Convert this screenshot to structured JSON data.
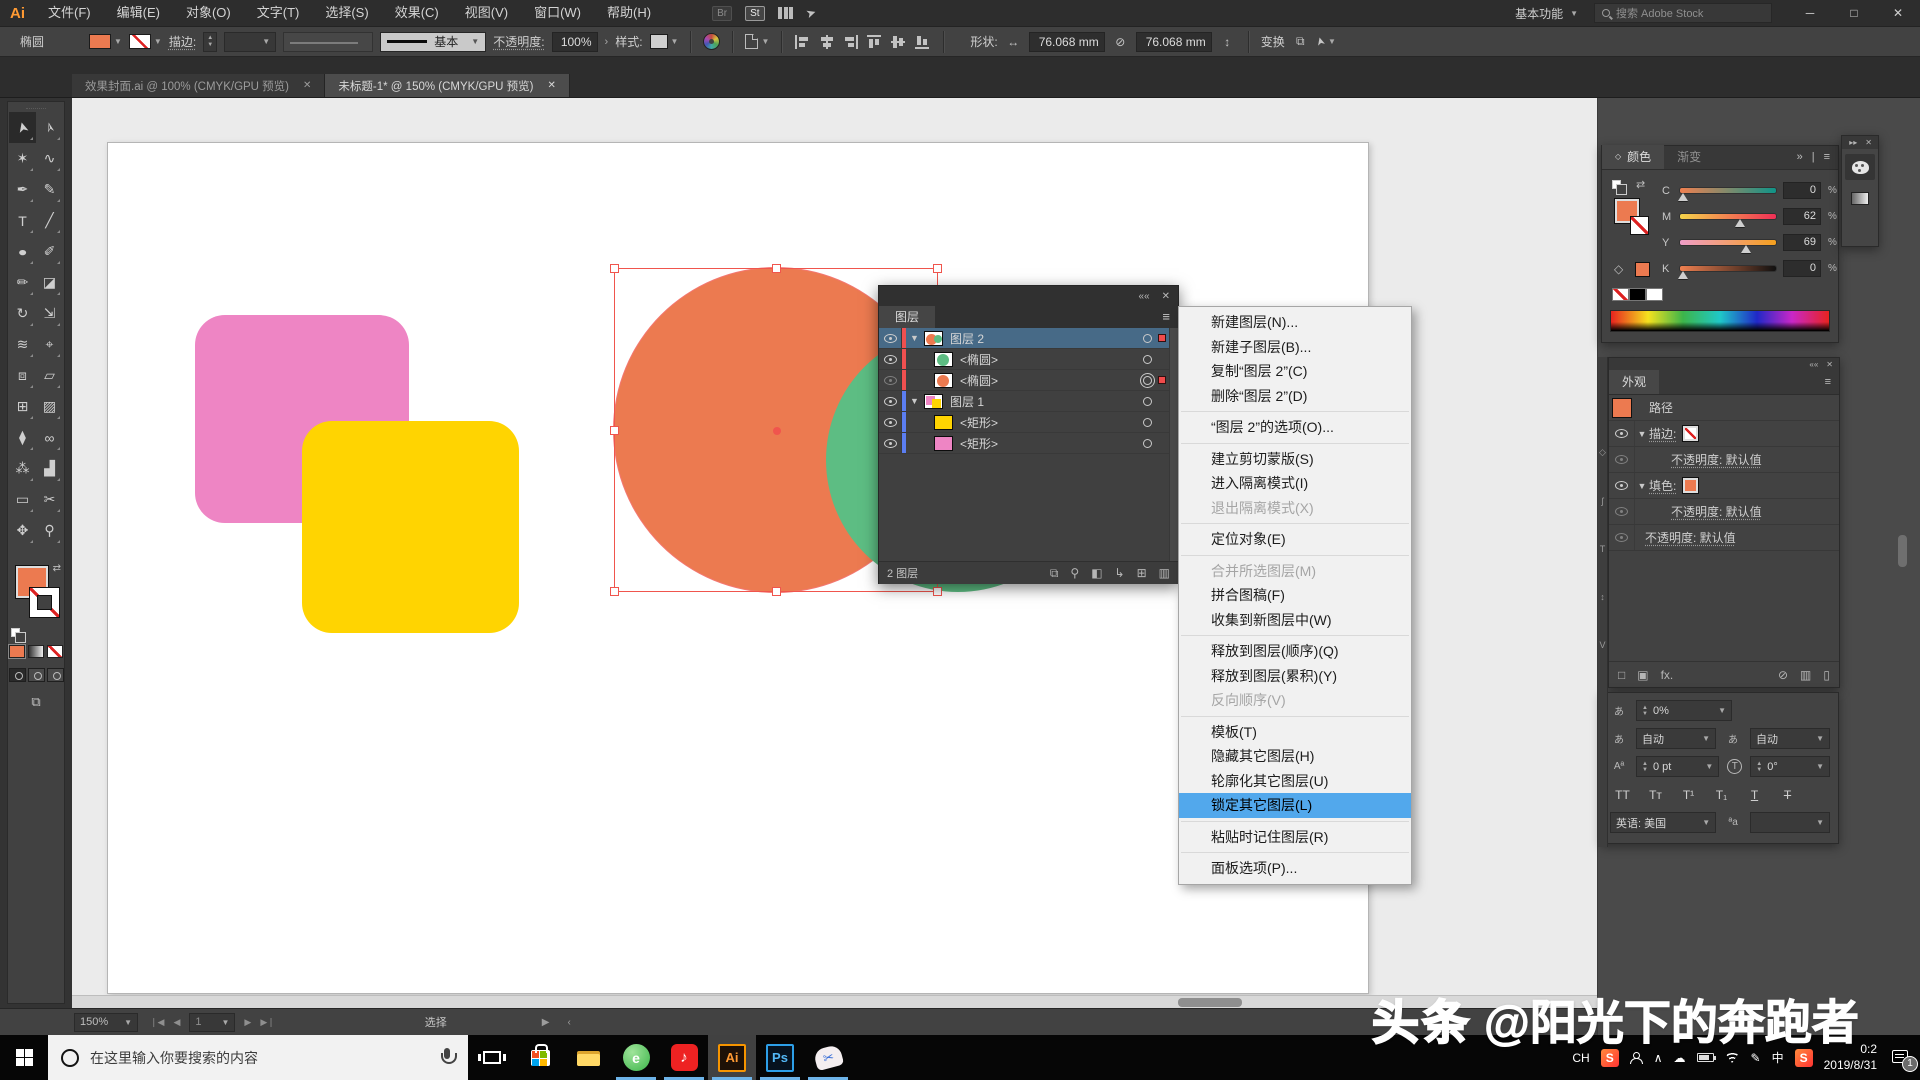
{
  "app": {
    "logo": "Ai",
    "workspace": "基本功能",
    "search_placeholder": "搜索 Adobe Stock",
    "bridge": "Br",
    "stock": "St"
  },
  "window_controls": {
    "minimize": "─",
    "maximize": "□",
    "close": "✕"
  },
  "menu_bar": {
    "items": [
      "文件(F)",
      "编辑(E)",
      "对象(O)",
      "文字(T)",
      "选择(S)",
      "效果(C)",
      "视图(V)",
      "窗口(W)",
      "帮助(H)"
    ]
  },
  "control_bar": {
    "tool": "椭圆",
    "stroke_label": "描边:",
    "brush_basic": "基本",
    "opacity_label": "不透明度:",
    "opacity_value": "100%",
    "style_label": "样式:",
    "shape_label": "形状:",
    "width": "76.068 mm",
    "height": "76.068 mm",
    "transform": "变换"
  },
  "tabs": [
    {
      "title": "效果封面.ai @ 100% (CMYK/GPU 预览)",
      "active": false
    },
    {
      "title": "未标题-1* @ 150% (CMYK/GPU 预览)",
      "active": true
    }
  ],
  "tools": [
    {
      "name": "selection",
      "glyph": "➤",
      "active": true,
      "rotate": true
    },
    {
      "name": "direct-selection",
      "glyph": "➢",
      "rotate": true
    },
    {
      "name": "magic-wand",
      "glyph": "✶"
    },
    {
      "name": "lasso",
      "glyph": "∿"
    },
    {
      "name": "pen",
      "glyph": "✒"
    },
    {
      "name": "curvature",
      "glyph": "✎"
    },
    {
      "name": "type",
      "glyph": "T"
    },
    {
      "name": "line-segment",
      "glyph": "╱"
    },
    {
      "name": "ellipse",
      "glyph": "●",
      "wide": true
    },
    {
      "name": "paintbrush",
      "glyph": "✐"
    },
    {
      "name": "shaper",
      "glyph": "✏"
    },
    {
      "name": "eraser",
      "glyph": "◪"
    },
    {
      "name": "rotate",
      "glyph": "↻"
    },
    {
      "name": "scale",
      "glyph": "⇲"
    },
    {
      "name": "width-tool",
      "glyph": "≋"
    },
    {
      "name": "puppet-warp",
      "glyph": "⌖"
    },
    {
      "name": "shape-builder",
      "glyph": "⧈"
    },
    {
      "name": "perspective-grid",
      "glyph": "▱"
    },
    {
      "name": "mesh",
      "glyph": "⊞"
    },
    {
      "name": "gradient",
      "glyph": "▨"
    },
    {
      "name": "eyedropper",
      "glyph": "⧫"
    },
    {
      "name": "blend",
      "glyph": "∞"
    },
    {
      "name": "symbol-sprayer",
      "glyph": "⁂"
    },
    {
      "name": "column-graph",
      "glyph": "▟"
    },
    {
      "name": "artboard",
      "glyph": "▭"
    },
    {
      "name": "slice",
      "glyph": "✂"
    },
    {
      "name": "hand",
      "glyph": "✥"
    },
    {
      "name": "zoom",
      "glyph": "⚲"
    }
  ],
  "canvas": {
    "artboard_color": "#ffffff",
    "shapes": {
      "pink": "#ee85c4",
      "yellow": "#ffd401",
      "orange": "#ec7a50",
      "green": "#5dbd83"
    },
    "selection_color": "#f0554d"
  },
  "layer_colors": {
    "red": "#f05050",
    "blue": "#5b7ef2"
  },
  "layers_panel": {
    "title": "图层",
    "rows": [
      {
        "name": "图层 2",
        "type": "layer",
        "color": "red",
        "thumb": "circles",
        "selected": true,
        "expanded": true,
        "target": "single",
        "proxy": true
      },
      {
        "name": "<椭圆>",
        "type": "item",
        "color": "red",
        "thumb": "green"
      },
      {
        "name": "<椭圆>",
        "type": "item",
        "color": "red",
        "thumb": "orange",
        "target": "double",
        "proxy": true,
        "dim": true
      },
      {
        "name": "图层 1",
        "type": "layer",
        "color": "blue",
        "thumb": "rects",
        "expanded": true,
        "target": "single"
      },
      {
        "name": "<矩形>",
        "type": "item",
        "color": "blue",
        "thumb": "yellow"
      },
      {
        "name": "<矩形>",
        "type": "item",
        "color": "blue",
        "thumb": "pink"
      }
    ],
    "status": "2 图层",
    "foot_icons": [
      {
        "name": "collect-for-export-icon",
        "glyph": "⧉"
      },
      {
        "name": "locate-object-icon",
        "glyph": "⚲"
      },
      {
        "name": "make-mask-icon",
        "glyph": "◧"
      },
      {
        "name": "new-sublayer-icon",
        "glyph": "↳"
      },
      {
        "name": "new-layer-icon",
        "glyph": "⊞"
      },
      {
        "name": "delete-selection-icon",
        "glyph": "▥"
      }
    ]
  },
  "context_menu": {
    "items": [
      {
        "label": "新建图层(N)..."
      },
      {
        "label": "新建子图层(B)..."
      },
      {
        "label": "复制“图层 2”(C)"
      },
      {
        "label": "删除“图层 2”(D)"
      },
      {
        "sep": true
      },
      {
        "label": "“图层 2”的选项(O)..."
      },
      {
        "sep": true
      },
      {
        "label": "建立剪切蒙版(S)"
      },
      {
        "label": "进入隔离模式(I)"
      },
      {
        "label": "退出隔离模式(X)",
        "disabled": true
      },
      {
        "sep": true
      },
      {
        "label": "定位对象(E)"
      },
      {
        "sep": true
      },
      {
        "label": "合并所选图层(M)",
        "disabled": true
      },
      {
        "label": "拼合图稿(F)"
      },
      {
        "label": "收集到新图层中(W)"
      },
      {
        "sep": true
      },
      {
        "label": "释放到图层(顺序)(Q)"
      },
      {
        "label": "释放到图层(累积)(Y)"
      },
      {
        "label": "反向顺序(V)",
        "disabled": true
      },
      {
        "sep": true
      },
      {
        "label": "模板(T)"
      },
      {
        "label": "隐藏其它图层(H)"
      },
      {
        "label": "轮廓化其它图层(U)"
      },
      {
        "label": "锁定其它图层(L)",
        "highlighted": true
      },
      {
        "sep": true
      },
      {
        "label": "粘贴时记住图层(R)"
      },
      {
        "sep": true
      },
      {
        "label": "面板选项(P)..."
      }
    ]
  },
  "color_panel": {
    "tab_color": "颜色",
    "tab_gradient": "渐变",
    "unit": "%",
    "sliders": [
      {
        "ch": "C",
        "value": "0",
        "pos": 3,
        "from": "#f08050",
        "to": "#0f9488"
      },
      {
        "ch": "M",
        "value": "62",
        "pos": 62,
        "from": "#f5d44a",
        "to": "#ef2f56"
      },
      {
        "ch": "Y",
        "value": "69",
        "pos": 69,
        "from": "#f09ec8",
        "to": "#f5a01e"
      },
      {
        "ch": "K",
        "value": "0",
        "pos": 3,
        "from": "#f08050",
        "to": "#101010"
      }
    ]
  },
  "appearance_panel": {
    "title": "外观",
    "rows": [
      {
        "label": "路径",
        "swatch": "orange_lg"
      },
      {
        "label": "描边:",
        "eye": "on",
        "chev": true,
        "swatch": "none",
        "link": true
      },
      {
        "label": "不透明度: 默认值",
        "eye": "dim",
        "indent": 36,
        "link": true
      },
      {
        "label": "填色:",
        "eye": "on",
        "chev": true,
        "swatch": "orange",
        "link": true
      },
      {
        "label": "不透明度: 默认值",
        "eye": "dim",
        "indent": 36,
        "link": true
      },
      {
        "label": "不透明度: 默认值",
        "eye": "dim",
        "indent": 10,
        "link": true
      }
    ],
    "foot_icons": [
      {
        "name": "add-new-stroke-icon",
        "glyph": "□"
      },
      {
        "name": "add-new-fill-icon",
        "glyph": "▣"
      },
      {
        "name": "add-effect-icon",
        "glyph": "fx."
      },
      {
        "name": "clear-appearance-icon",
        "glyph": "⊘"
      },
      {
        "name": "duplicate-item-icon",
        "glyph": "▥"
      },
      {
        "name": "delete-item-icon",
        "glyph": "▯"
      }
    ]
  },
  "char_panel": {
    "tracking": "0%",
    "auto1": "自动",
    "auto2": "自动",
    "baseline": "0 pt",
    "rotation": "0°",
    "language_label": "英语: 美国",
    "buttons": [
      {
        "name": "all-caps-button",
        "label": "TT"
      },
      {
        "name": "small-caps-button",
        "label": "Tт"
      },
      {
        "name": "superscript-button",
        "label": "T¹"
      },
      {
        "name": "subscript-button",
        "label": "T₁"
      },
      {
        "name": "underline-button",
        "label": "T",
        "style": "u"
      },
      {
        "name": "strikethrough-button",
        "label": "T",
        "style": "s"
      }
    ]
  },
  "status_bar": {
    "zoom": "150%",
    "page": "1",
    "mode": "选择"
  },
  "taskbar": {
    "search_placeholder": "在这里输入你要搜索的内容",
    "apps": [
      {
        "name": "task-view"
      },
      {
        "name": "store"
      },
      {
        "name": "explorer"
      },
      {
        "name": "browser-360",
        "running": true
      },
      {
        "name": "netease-music",
        "running": true
      },
      {
        "name": "illustrator",
        "running": true,
        "active": true
      },
      {
        "name": "photoshop",
        "running": true
      },
      {
        "name": "snip-tool",
        "running": true
      }
    ],
    "lang": "CH",
    "sogou": "S",
    "ime": "中",
    "time": "0:2",
    "date": "2019/8/31",
    "badge": "1"
  },
  "watermark": {
    "brand": "头条",
    "handle": "@阳光下的奔跑者"
  }
}
